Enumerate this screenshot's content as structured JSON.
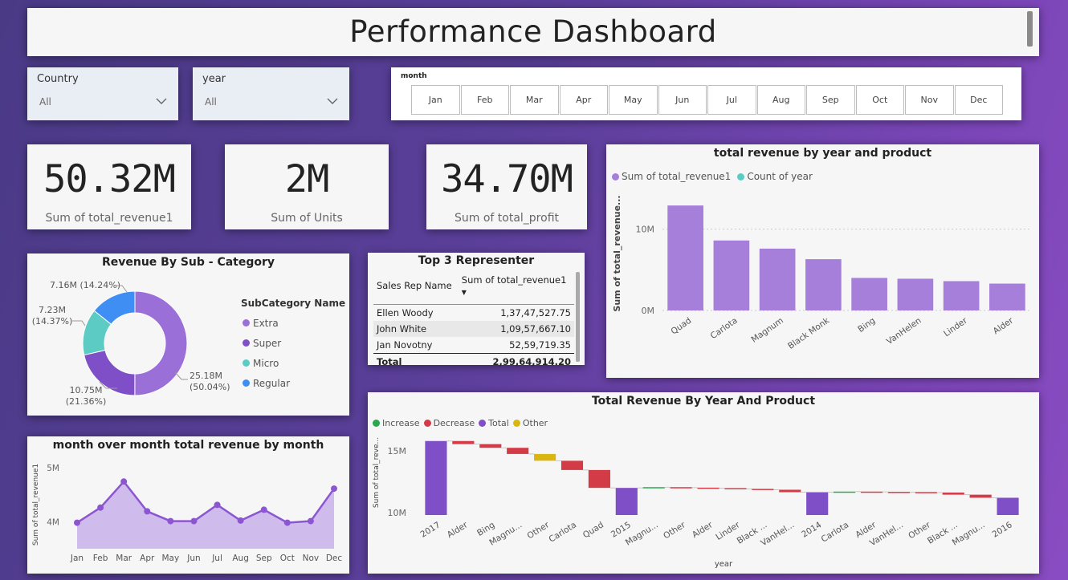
{
  "header": {
    "title": "Performance Dashboard"
  },
  "filters": {
    "country": {
      "label": "Country",
      "value": "All"
    },
    "year": {
      "label": "year",
      "value": "All"
    }
  },
  "month_slicer": {
    "label": "month",
    "months": [
      "Jan",
      "Feb",
      "Mar",
      "Apr",
      "May",
      "Jun",
      "Jul",
      "Aug",
      "Sep",
      "Oct",
      "Nov",
      "Dec"
    ]
  },
  "kpis": [
    {
      "value": "50.32M",
      "label": "Sum of total_revenue1"
    },
    {
      "value": "2M",
      "label": "Sum of Units"
    },
    {
      "value": "34.70M",
      "label": "Sum of total_profit"
    }
  ],
  "colors": {
    "purple": "#9b6fd8",
    "purple_dark": "#7e4fc6",
    "teal": "#5ccbc4",
    "blue": "#3f8ef3",
    "red": "#d33b46",
    "green": "#2aa84a",
    "yellow": "#d9b611",
    "bar": "#a57fd9"
  },
  "chart_data": [
    {
      "id": "revenue-by-subcategory",
      "type": "pie",
      "title": "Revenue By Sub - Category",
      "legend_title": "SubCategory Name",
      "categories": [
        "Extra",
        "Super",
        "Micro",
        "Regular"
      ],
      "values": [
        25.18,
        10.75,
        7.23,
        7.16
      ],
      "labels": [
        "25.18M (50.04%)",
        "10.75M (21.36%)",
        "7.23M (14.37%)",
        "7.16M (14.24%)"
      ],
      "colors": [
        "#9b6fd8",
        "#7e4fc6",
        "#5ccbc4",
        "#3f8ef3"
      ]
    },
    {
      "id": "revenue-by-year-product",
      "type": "bar",
      "title": "total revenue by year and product",
      "legend": [
        "Sum of total_revenue1",
        "Count of year"
      ],
      "ylabel": "Sum of total_revenue...",
      "yticks": [
        "0M",
        "10M"
      ],
      "ylim": [
        0,
        14
      ],
      "categories": [
        "Quad",
        "Carlota",
        "Magnum",
        "Black Monk",
        "Bing",
        "VanHelen",
        "Linder",
        "Alder"
      ],
      "values": [
        12.9,
        8.6,
        7.6,
        6.3,
        4.0,
        3.9,
        3.6,
        3.3
      ]
    },
    {
      "id": "mom-revenue",
      "type": "area",
      "title": "month over month total revenue by month",
      "ylabel": "Sum of total_revenue1",
      "yticks": [
        "4M",
        "5M"
      ],
      "ylim": [
        3.5,
        5.1
      ],
      "categories": [
        "Jan",
        "Feb",
        "Mar",
        "Apr",
        "May",
        "Jun",
        "Jul",
        "Aug",
        "Sep",
        "Oct",
        "Nov",
        "Dec"
      ],
      "values": [
        3.98,
        4.26,
        4.74,
        4.19,
        4.01,
        4.01,
        4.31,
        4.02,
        4.22,
        3.98,
        4.01,
        4.61
      ]
    },
    {
      "id": "waterfall-revenue",
      "type": "bar",
      "title": "Total Revenue By Year And Product",
      "legend": [
        "Increase",
        "Decrease",
        "Total",
        "Other"
      ],
      "ylabel": "Sum of total_reve...",
      "xlabel": "year",
      "yticks": [
        "10M",
        "15M"
      ],
      "ylim": [
        9.8,
        16.5
      ],
      "categories": [
        "2017",
        "Alder",
        "Bing",
        "Magnu...",
        "Other",
        "Carlota",
        "Quad",
        "2015",
        "Magnu...",
        "Other",
        "Alder",
        "Linder",
        "Black ...",
        "VanHel...",
        "2014",
        "Carlota",
        "Alder",
        "VanHel...",
        "Other",
        "Black ...",
        "Magnu...",
        "2016"
      ],
      "segments": [
        {
          "kind": "total",
          "start": 9.8,
          "end": 15.8
        },
        {
          "kind": "decrease",
          "start": 15.8,
          "end": 15.55
        },
        {
          "kind": "decrease",
          "start": 15.55,
          "end": 15.25
        },
        {
          "kind": "decrease",
          "start": 15.25,
          "end": 14.75
        },
        {
          "kind": "other",
          "start": 14.75,
          "end": 14.2
        },
        {
          "kind": "decrease",
          "start": 14.2,
          "end": 13.45
        },
        {
          "kind": "decrease",
          "start": 13.45,
          "end": 12.0
        },
        {
          "kind": "total",
          "start": 9.8,
          "end": 12.0
        },
        {
          "kind": "increase",
          "start": 12.0,
          "end": 12.06
        },
        {
          "kind": "decrease",
          "start": 12.06,
          "end": 12.02
        },
        {
          "kind": "decrease",
          "start": 12.02,
          "end": 11.98
        },
        {
          "kind": "decrease",
          "start": 11.98,
          "end": 11.92
        },
        {
          "kind": "decrease",
          "start": 11.92,
          "end": 11.85
        },
        {
          "kind": "decrease",
          "start": 11.85,
          "end": 11.65
        },
        {
          "kind": "total",
          "start": 9.8,
          "end": 11.65
        },
        {
          "kind": "increase",
          "start": 11.65,
          "end": 11.7
        },
        {
          "kind": "decrease",
          "start": 11.7,
          "end": 11.68
        },
        {
          "kind": "decrease",
          "start": 11.68,
          "end": 11.66
        },
        {
          "kind": "decrease",
          "start": 11.66,
          "end": 11.62
        },
        {
          "kind": "decrease",
          "start": 11.62,
          "end": 11.45
        },
        {
          "kind": "decrease",
          "start": 11.45,
          "end": 11.2
        },
        {
          "kind": "total",
          "start": 9.8,
          "end": 11.2
        }
      ]
    }
  ],
  "top_reps": {
    "title": "Top 3 Representer",
    "columns": [
      "Sales Rep Name",
      "Sum of total_revenue1"
    ],
    "rows": [
      [
        "Ellen Woody",
        "1,37,47,527.75"
      ],
      [
        "John White",
        "1,09,57,667.10"
      ],
      [
        "Jan Novotny",
        "52,59,719.35"
      ]
    ],
    "total": [
      "Total",
      "2,99,64,914.20"
    ]
  }
}
